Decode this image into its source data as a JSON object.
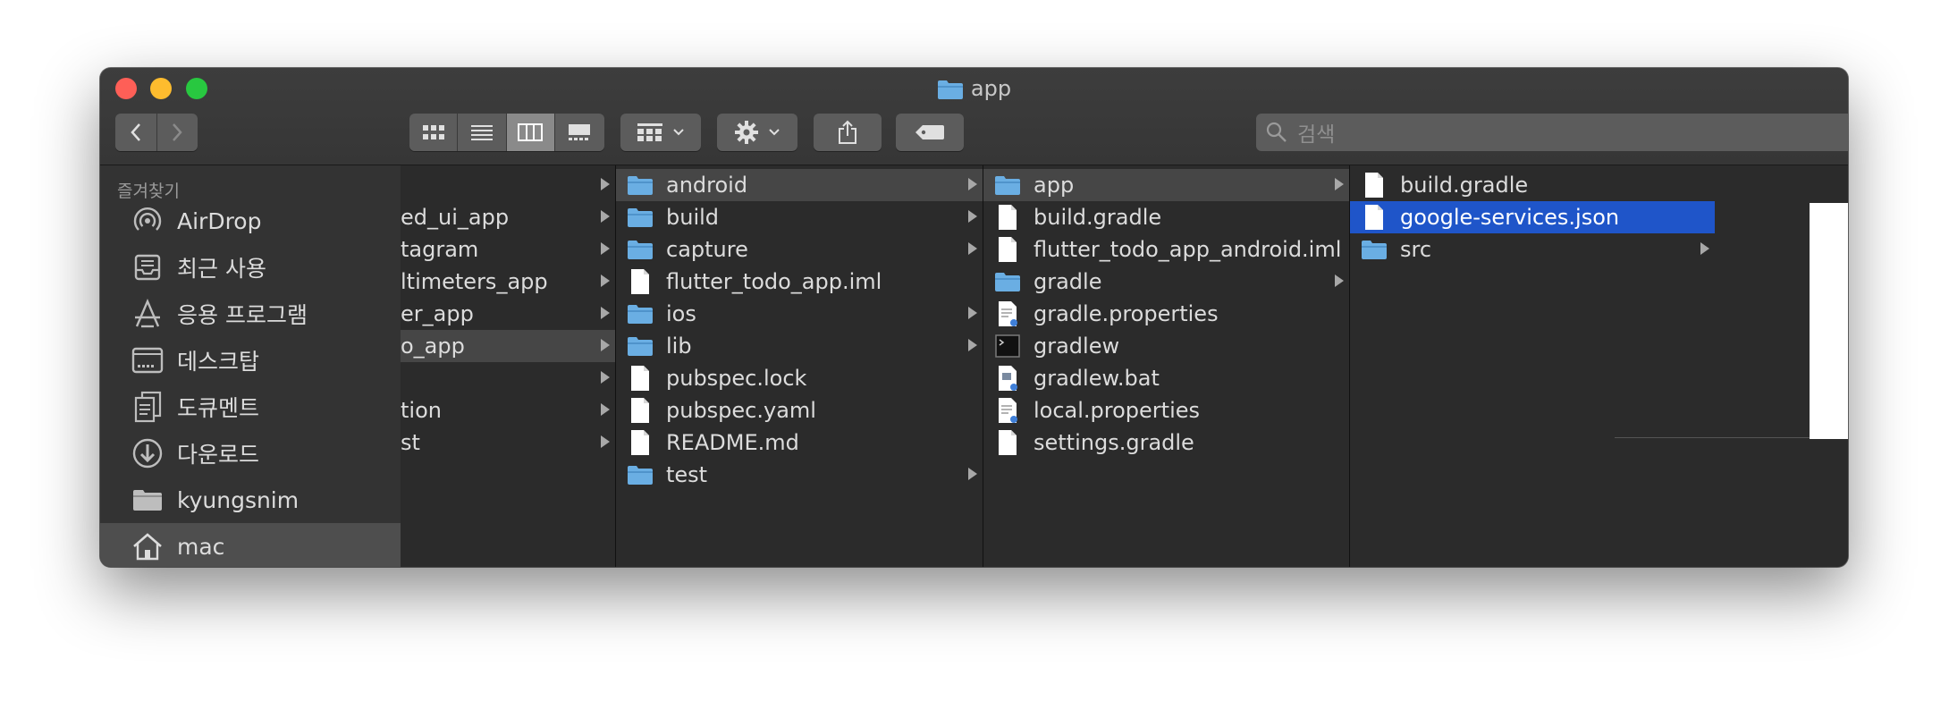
{
  "window": {
    "title": "app"
  },
  "toolbar": {
    "search_placeholder": "검색"
  },
  "sidebar": {
    "header": "즐겨찾기",
    "items": [
      {
        "label": "AirDrop",
        "icon": "airdrop-icon"
      },
      {
        "label": "최근 사용",
        "icon": "recents-icon"
      },
      {
        "label": "응용 프로그램",
        "icon": "applications-icon"
      },
      {
        "label": "데스크탑",
        "icon": "desktop-icon"
      },
      {
        "label": "도큐멘트",
        "icon": "documents-icon"
      },
      {
        "label": "다운로드",
        "icon": "downloads-icon"
      },
      {
        "label": "kyungsnim",
        "icon": "folder-icon"
      },
      {
        "label": "mac",
        "icon": "home-icon"
      }
    ]
  },
  "columns": [
    {
      "rows": [
        {
          "label": "",
          "arrow": true
        },
        {
          "label": "ed_ui_app",
          "arrow": true
        },
        {
          "label": "tagram",
          "arrow": true
        },
        {
          "label": "ltimeters_app",
          "arrow": true
        },
        {
          "label": "er_app",
          "arrow": true
        },
        {
          "label": "o_app",
          "arrow": true,
          "highlight": true
        },
        {
          "label": "",
          "arrow": true
        },
        {
          "label": "tion",
          "arrow": true
        },
        {
          "label": "st",
          "arrow": true
        }
      ]
    },
    {
      "rows": [
        {
          "label": "android",
          "icon": "folder",
          "arrow": true,
          "highlight": true
        },
        {
          "label": "build",
          "icon": "folder",
          "arrow": true
        },
        {
          "label": "capture",
          "icon": "folder",
          "arrow": true
        },
        {
          "label": "flutter_todo_app.iml",
          "icon": "file"
        },
        {
          "label": "ios",
          "icon": "folder",
          "arrow": true
        },
        {
          "label": "lib",
          "icon": "folder",
          "arrow": true
        },
        {
          "label": "pubspec.lock",
          "icon": "file"
        },
        {
          "label": "pubspec.yaml",
          "icon": "file"
        },
        {
          "label": "README.md",
          "icon": "file"
        },
        {
          "label": "test",
          "icon": "folder",
          "arrow": true
        }
      ]
    },
    {
      "rows": [
        {
          "label": "app",
          "icon": "folder",
          "arrow": true,
          "highlight": true
        },
        {
          "label": "build.gradle",
          "icon": "file"
        },
        {
          "label": "flutter_todo_app_android.iml",
          "icon": "file"
        },
        {
          "label": "gradle",
          "icon": "folder",
          "arrow": true
        },
        {
          "label": "gradle.properties",
          "icon": "props"
        },
        {
          "label": "gradlew",
          "icon": "exec"
        },
        {
          "label": "gradlew.bat",
          "icon": "props"
        },
        {
          "label": "local.properties",
          "icon": "props"
        },
        {
          "label": "settings.gradle",
          "icon": "file"
        }
      ]
    },
    {
      "rows": [
        {
          "label": "build.gradle",
          "icon": "file"
        },
        {
          "label": "google-services.json",
          "icon": "file",
          "selected": true
        },
        {
          "label": "src",
          "icon": "folder",
          "arrow": true
        }
      ]
    }
  ],
  "colors": {
    "selection": "#1f55c9",
    "folder": "#6aaee3",
    "close": "#fe5f57",
    "minimize": "#febc2e",
    "zoom": "#28c840"
  }
}
